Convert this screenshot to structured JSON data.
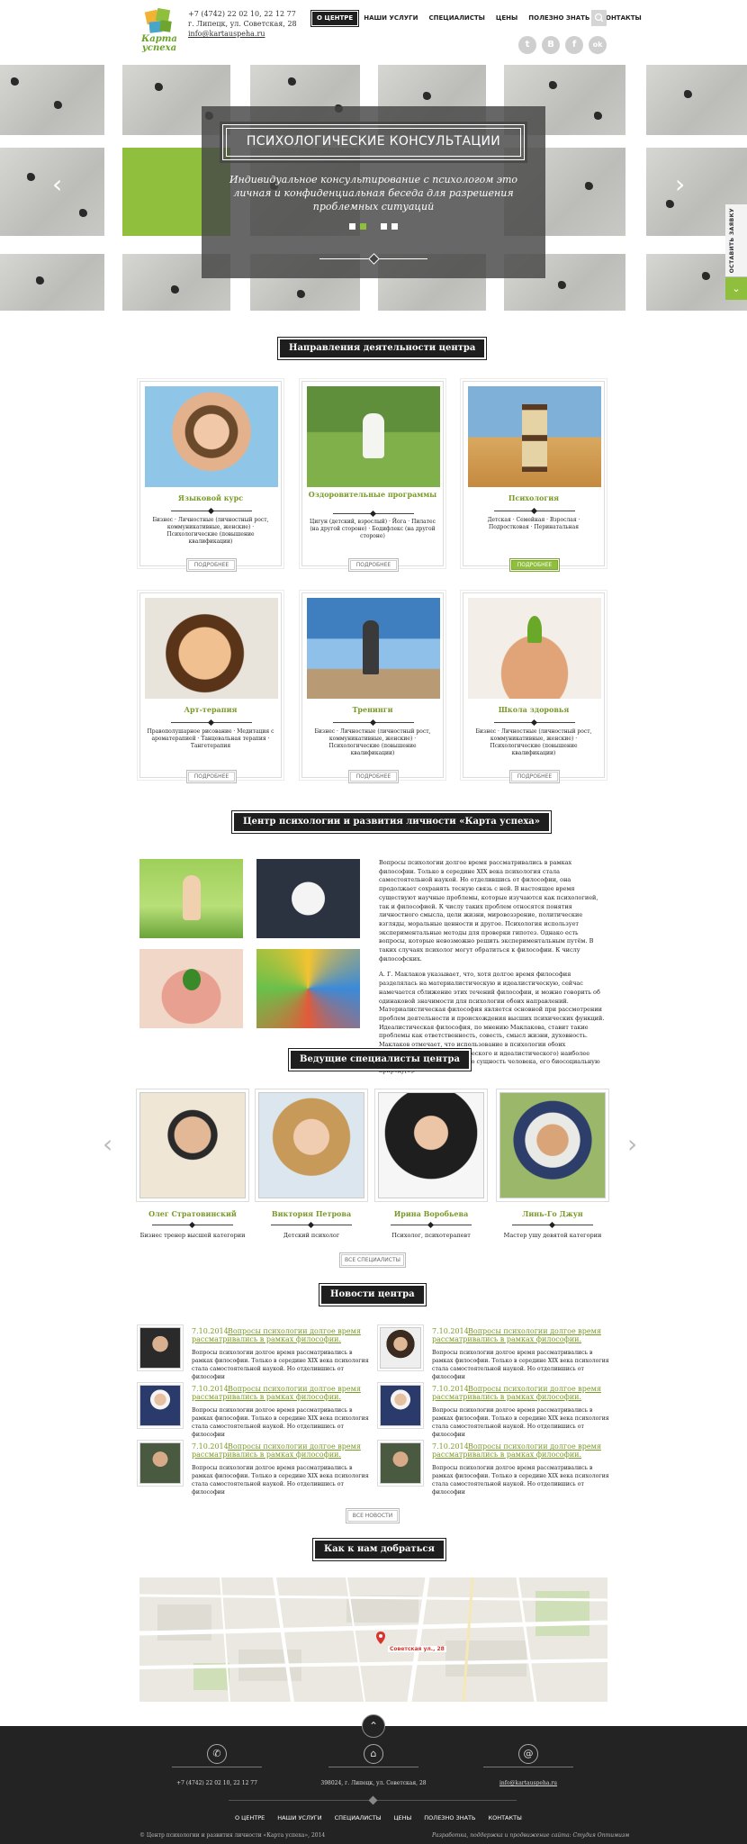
{
  "header": {
    "logo_text": "Карта успеха",
    "phone": "+7 (4742) 22 02 10, 22 12 77",
    "address": "г. Липецк, ул. Советская, 28",
    "email": "info@kartauspeha.ru",
    "nav": [
      "О ЦЕНТРЕ",
      "НАШИ УСЛУГИ",
      "СПЕЦИАЛИСТЫ",
      "ЦЕНЫ",
      "ПОЛЕЗНО ЗНАТЬ",
      "КОНТАКТЫ"
    ],
    "social": [
      "t",
      "В",
      "f",
      "ok"
    ]
  },
  "slider": {
    "title": "ПСИХОЛОГИЧЕСКИЕ КОНСУЛЬТАЦИИ",
    "text": "Индивидуальное консультирование с психологом это личная и конфиденциальная беседа для разрешения проблемных ситуаций",
    "side_tab": "ОСТАВИТЬ ЗАЯВКУ",
    "dots": 4,
    "active_dot": 2
  },
  "directions": {
    "title": "Направления деятельности центра",
    "cards": [
      {
        "title": "Языковой курс",
        "tags": "Бизнес · Личностные (личностный рост, коммуникативные, женские) · Психологические (повышение квалификации)",
        "button": "ПОДРОБНЕЕ"
      },
      {
        "title": "Оздоровительные программы",
        "tags": "Цигун (детский, взрослый) · Йога · Пилатес (на другой стороне) · Бодифлекс (на другой стороне)",
        "button": "ПОДРОБНЕЕ"
      },
      {
        "title": "Психология",
        "tags": "Детская · Семейная · Взрослая · Подростковая · Перинатальная",
        "button": "ПОДРОБНЕЕ"
      },
      {
        "title": "Арт-терапия",
        "tags": "Правополушарное рисование · Медитация с ароматерапией · Танцевальная терапия · Тангетерапия",
        "button": "ПОДРОБНЕЕ"
      },
      {
        "title": "Тренинги",
        "tags": "Бизнес · Личностные (личностный рост, коммуникативные, женские) · Психологические (повышение квалификации)",
        "button": "ПОДРОБНЕЕ"
      },
      {
        "title": "Школа здоровья",
        "tags": "Бизнес · Личностные (личностный рост, коммуникативные, женские) · Психологические (повышение квалификации)",
        "button": "ПОДРОБНЕЕ"
      }
    ]
  },
  "about": {
    "title": "Центр психологии и развития личности «Карта успеха»",
    "p1": "Вопросы психологии долгое время рассматривались в рамках философии. Только в середине XIX века психология стала самостоятельной наукой. Но отделившись от философии, она продолжает сохранять тесную связь с ней. В настоящее время существуют научные проблемы, которые изучаются как психологией, так и философией. К числу таких проблем относятся понятия личностного смысла, цели жизни, мировоззрение, политические взгляды, моральные ценности и другое. Психология использует экспериментальные методы для проверки гипотез. Однако есть вопросы, которые невозможно решить экспериментальным путём. В таких случаях психолог могут обратиться к философии. К числу философских.",
    "p2": "А. Г. Маклаков указывает, что, хотя долгое время философия разделялась на материалистическую и идеалистическую, сейчас намечается сближение этих течений философии, и можно говорить об одинаковой значимости для психологии обоих направлений. Материалистическая философия является основной при рассмотрении проблем деятельности и происхождения высших психических функций. Идеалистическая философия, по мнению Маклакова, ставит такие проблемы как ответственность, совесть, смысл жизни, духовность. Маклаков отмечает, что использование в психологии обоих направлений (материалистического и идеалистического) наиболее полно отражает двойственную сущность человека, его биосоциальную природу[5]."
  },
  "specialists": {
    "title": "Ведущие специалисты центра",
    "items": [
      {
        "name": "Олег Стратовинский",
        "role": "Бизнес тренер высшей категории"
      },
      {
        "name": "Виктория Петрова",
        "role": "Детский психолог"
      },
      {
        "name": "Ирина Воробьева",
        "role": "Психолог, психотерапевт"
      },
      {
        "name": "Линь-Го Джун",
        "role": "Мастер ушу девятой категории"
      }
    ],
    "all_button": "ВСЕ СПЕЦИАЛИСТЫ"
  },
  "news": {
    "title": "Новости центра",
    "items": [
      {
        "date": "7.10.2014",
        "title": "Вопросы психологии долгое время рассматривались в рамках философии.",
        "text": "Вопросы психологии долгое время рассматривались в рамках философии. Только в середине XIX века психология стала самостоятельной наукой. Но отделившись от философии"
      },
      {
        "date": "7.10.2014",
        "title": "Вопросы психологии долгое время рассматривались в рамках философии.",
        "text": "Вопросы психологии долгое время рассматривались в рамках философии. Только в середине XIX века психология стала самостоятельной наукой. Но отделившись от философии"
      },
      {
        "date": "7.10.2014",
        "title": "Вопросы психологии долгое время рассматривались в рамках философии.",
        "text": "Вопросы психологии долгое время рассматривались в рамках философии. Только в середине XIX века психология стала самостоятельной наукой. Но отделившись от философии"
      },
      {
        "date": "7.10.2014",
        "title": "Вопросы психологии долгое время рассматривались в рамках философии.",
        "text": "Вопросы психологии долгое время рассматривались в рамках философии. Только в середине XIX века психология стала самостоятельной наукой. Но отделившись от философии"
      },
      {
        "date": "7.10.2014",
        "title": "Вопросы психологии долгое время рассматривались в рамках философии.",
        "text": "Вопросы психологии долгое время рассматривались в рамках философии. Только в середине XIX века психология стала самостоятельной наукой. Но отделившись от философии"
      },
      {
        "date": "7.10.2014",
        "title": "Вопросы психологии долгое время рассматривались в рамках философии.",
        "text": "Вопросы психологии долгое время рассматривались в рамках философии. Только в середине XIX века психология стала самостоятельной наукой. Но отделившись от философии"
      }
    ],
    "all_button": "ВСЕ НОВОСТИ"
  },
  "map": {
    "title": "Как к нам добраться",
    "marker_label": "Советская ул., 28"
  },
  "footer": {
    "phone": "+7 (4742) 22 02 10, 22 12 77",
    "address": "398024, г. Липецк, ул. Советская, 28",
    "email": "info@kartauspeha.ru",
    "nav": [
      "О ЦЕНТРЕ",
      "НАШИ УСЛУГИ",
      "СПЕЦИАЛИСТЫ",
      "ЦЕНЫ",
      "ПОЛЕЗНО ЗНАТЬ",
      "КОНТАКТЫ"
    ],
    "copyright": "© Центр психологии и развития личности «Карта успеха», 2014",
    "credits": "Разработка, поддержка и продвижение сайта: Студия Оптимизм"
  },
  "colors": {
    "accent": "#8fbf3c",
    "dark": "#1e1e1e",
    "title_green": "#7a9a28"
  }
}
